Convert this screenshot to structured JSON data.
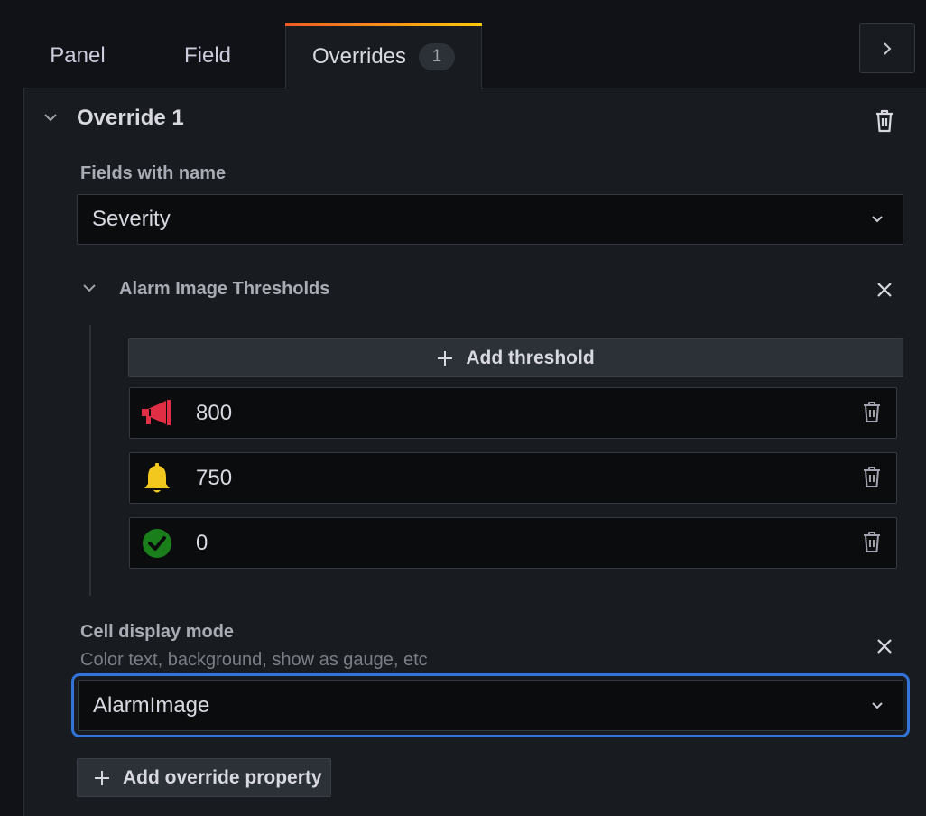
{
  "tabs": [
    {
      "label": "Panel"
    },
    {
      "label": "Field"
    },
    {
      "label": "Overrides",
      "badge": "1",
      "active": true
    }
  ],
  "override": {
    "title": "Override 1",
    "matcher_label": "Fields with name",
    "matcher_value": "Severity",
    "thresholds": {
      "title": "Alarm Image Thresholds",
      "add_label": "Add threshold",
      "rows": [
        {
          "value": "800",
          "icon": "megaphone-icon",
          "color": "#e02f44"
        },
        {
          "value": "750",
          "icon": "bell-icon",
          "color": "#f2c71e"
        },
        {
          "value": "0",
          "icon": "check-circle-icon",
          "color": "#1a7f1a"
        }
      ]
    },
    "cell_display": {
      "label": "Cell display mode",
      "description": "Color text, background, show as gauge, etc",
      "value": "AlarmImage"
    },
    "add_property_label": "Add override property"
  },
  "colors": {
    "focus": "#3274d9",
    "tab_gradient_start": "#f05a28",
    "tab_gradient_end": "#fbca0a"
  }
}
